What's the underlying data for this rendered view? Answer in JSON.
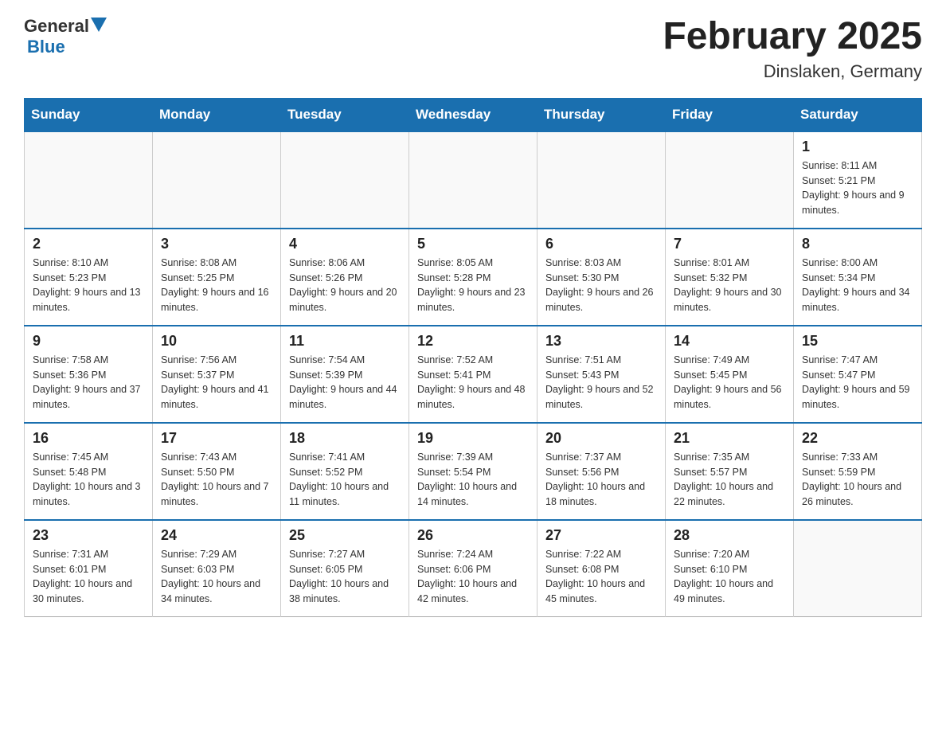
{
  "header": {
    "logo_text_general": "General",
    "logo_text_blue": "Blue",
    "month_title": "February 2025",
    "location": "Dinslaken, Germany"
  },
  "weekdays": [
    "Sunday",
    "Monday",
    "Tuesday",
    "Wednesday",
    "Thursday",
    "Friday",
    "Saturday"
  ],
  "weeks": [
    {
      "days": [
        {
          "number": "",
          "info": "",
          "empty": true
        },
        {
          "number": "",
          "info": "",
          "empty": true
        },
        {
          "number": "",
          "info": "",
          "empty": true
        },
        {
          "number": "",
          "info": "",
          "empty": true
        },
        {
          "number": "",
          "info": "",
          "empty": true
        },
        {
          "number": "",
          "info": "",
          "empty": true
        },
        {
          "number": "1",
          "info": "Sunrise: 8:11 AM\nSunset: 5:21 PM\nDaylight: 9 hours and 9 minutes.",
          "empty": false
        }
      ]
    },
    {
      "days": [
        {
          "number": "2",
          "info": "Sunrise: 8:10 AM\nSunset: 5:23 PM\nDaylight: 9 hours and 13 minutes.",
          "empty": false
        },
        {
          "number": "3",
          "info": "Sunrise: 8:08 AM\nSunset: 5:25 PM\nDaylight: 9 hours and 16 minutes.",
          "empty": false
        },
        {
          "number": "4",
          "info": "Sunrise: 8:06 AM\nSunset: 5:26 PM\nDaylight: 9 hours and 20 minutes.",
          "empty": false
        },
        {
          "number": "5",
          "info": "Sunrise: 8:05 AM\nSunset: 5:28 PM\nDaylight: 9 hours and 23 minutes.",
          "empty": false
        },
        {
          "number": "6",
          "info": "Sunrise: 8:03 AM\nSunset: 5:30 PM\nDaylight: 9 hours and 26 minutes.",
          "empty": false
        },
        {
          "number": "7",
          "info": "Sunrise: 8:01 AM\nSunset: 5:32 PM\nDaylight: 9 hours and 30 minutes.",
          "empty": false
        },
        {
          "number": "8",
          "info": "Sunrise: 8:00 AM\nSunset: 5:34 PM\nDaylight: 9 hours and 34 minutes.",
          "empty": false
        }
      ]
    },
    {
      "days": [
        {
          "number": "9",
          "info": "Sunrise: 7:58 AM\nSunset: 5:36 PM\nDaylight: 9 hours and 37 minutes.",
          "empty": false
        },
        {
          "number": "10",
          "info": "Sunrise: 7:56 AM\nSunset: 5:37 PM\nDaylight: 9 hours and 41 minutes.",
          "empty": false
        },
        {
          "number": "11",
          "info": "Sunrise: 7:54 AM\nSunset: 5:39 PM\nDaylight: 9 hours and 44 minutes.",
          "empty": false
        },
        {
          "number": "12",
          "info": "Sunrise: 7:52 AM\nSunset: 5:41 PM\nDaylight: 9 hours and 48 minutes.",
          "empty": false
        },
        {
          "number": "13",
          "info": "Sunrise: 7:51 AM\nSunset: 5:43 PM\nDaylight: 9 hours and 52 minutes.",
          "empty": false
        },
        {
          "number": "14",
          "info": "Sunrise: 7:49 AM\nSunset: 5:45 PM\nDaylight: 9 hours and 56 minutes.",
          "empty": false
        },
        {
          "number": "15",
          "info": "Sunrise: 7:47 AM\nSunset: 5:47 PM\nDaylight: 9 hours and 59 minutes.",
          "empty": false
        }
      ]
    },
    {
      "days": [
        {
          "number": "16",
          "info": "Sunrise: 7:45 AM\nSunset: 5:48 PM\nDaylight: 10 hours and 3 minutes.",
          "empty": false
        },
        {
          "number": "17",
          "info": "Sunrise: 7:43 AM\nSunset: 5:50 PM\nDaylight: 10 hours and 7 minutes.",
          "empty": false
        },
        {
          "number": "18",
          "info": "Sunrise: 7:41 AM\nSunset: 5:52 PM\nDaylight: 10 hours and 11 minutes.",
          "empty": false
        },
        {
          "number": "19",
          "info": "Sunrise: 7:39 AM\nSunset: 5:54 PM\nDaylight: 10 hours and 14 minutes.",
          "empty": false
        },
        {
          "number": "20",
          "info": "Sunrise: 7:37 AM\nSunset: 5:56 PM\nDaylight: 10 hours and 18 minutes.",
          "empty": false
        },
        {
          "number": "21",
          "info": "Sunrise: 7:35 AM\nSunset: 5:57 PM\nDaylight: 10 hours and 22 minutes.",
          "empty": false
        },
        {
          "number": "22",
          "info": "Sunrise: 7:33 AM\nSunset: 5:59 PM\nDaylight: 10 hours and 26 minutes.",
          "empty": false
        }
      ]
    },
    {
      "days": [
        {
          "number": "23",
          "info": "Sunrise: 7:31 AM\nSunset: 6:01 PM\nDaylight: 10 hours and 30 minutes.",
          "empty": false
        },
        {
          "number": "24",
          "info": "Sunrise: 7:29 AM\nSunset: 6:03 PM\nDaylight: 10 hours and 34 minutes.",
          "empty": false
        },
        {
          "number": "25",
          "info": "Sunrise: 7:27 AM\nSunset: 6:05 PM\nDaylight: 10 hours and 38 minutes.",
          "empty": false
        },
        {
          "number": "26",
          "info": "Sunrise: 7:24 AM\nSunset: 6:06 PM\nDaylight: 10 hours and 42 minutes.",
          "empty": false
        },
        {
          "number": "27",
          "info": "Sunrise: 7:22 AM\nSunset: 6:08 PM\nDaylight: 10 hours and 45 minutes.",
          "empty": false
        },
        {
          "number": "28",
          "info": "Sunrise: 7:20 AM\nSunset: 6:10 PM\nDaylight: 10 hours and 49 minutes.",
          "empty": false
        },
        {
          "number": "",
          "info": "",
          "empty": true
        }
      ]
    }
  ]
}
